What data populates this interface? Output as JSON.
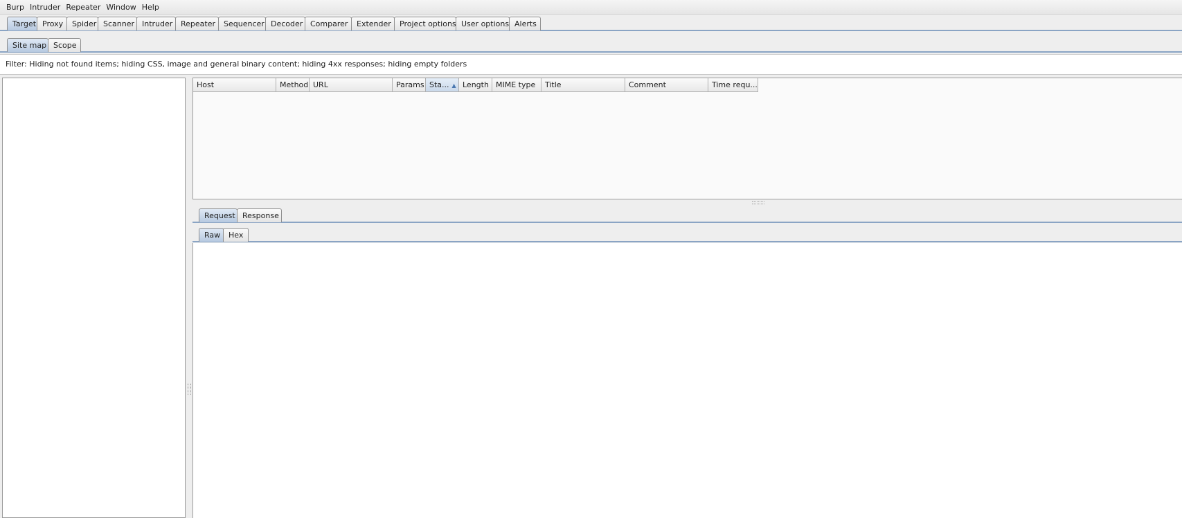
{
  "menu": [
    "Burp",
    "Intruder",
    "Repeater",
    "Window",
    "Help"
  ],
  "main_tabs": [
    {
      "label": "Target",
      "active": true
    },
    {
      "label": "Proxy"
    },
    {
      "label": "Spider"
    },
    {
      "label": "Scanner"
    },
    {
      "label": "Intruder"
    },
    {
      "label": "Repeater"
    },
    {
      "label": "Sequencer"
    },
    {
      "label": "Decoder"
    },
    {
      "label": "Comparer"
    },
    {
      "label": "Extender"
    },
    {
      "label": "Project options"
    },
    {
      "label": "User options"
    },
    {
      "label": "Alerts"
    }
  ],
  "sub_tabs": [
    {
      "label": "Site map",
      "active": true
    },
    {
      "label": "Scope"
    }
  ],
  "filter": {
    "text": "Filter:  Hiding not found items;  hiding CSS, image and general binary content;  hiding 4xx responses;  hiding empty folders"
  },
  "table": {
    "columns": [
      {
        "label": "Host"
      },
      {
        "label": "Method"
      },
      {
        "label": "URL"
      },
      {
        "label": "Params"
      },
      {
        "label": "Sta...",
        "sorted": true
      },
      {
        "label": "Length"
      },
      {
        "label": "MIME type"
      },
      {
        "label": "Title"
      },
      {
        "label": "Comment"
      },
      {
        "label": "Time requ..."
      }
    ],
    "rows": []
  },
  "message_tabs": [
    {
      "label": "Request",
      "active": true
    },
    {
      "label": "Response"
    }
  ],
  "view_tabs": [
    {
      "label": "Raw",
      "active": true
    },
    {
      "label": "Hex"
    }
  ],
  "colors": {
    "tab_active": "#b7c9e0",
    "tab_border": "#8aa4c4",
    "sort_arrow": "#4a78b0"
  }
}
